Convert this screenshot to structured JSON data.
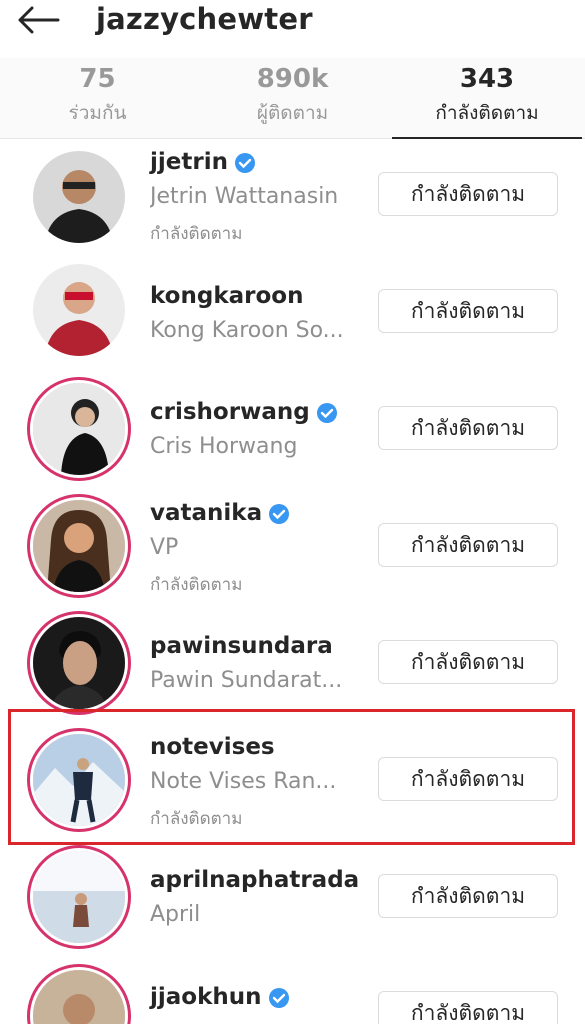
{
  "header": {
    "title": "jazzychewter",
    "back_icon": "arrow-left-icon"
  },
  "stats": [
    {
      "value": "75",
      "label": "ร่วมกัน"
    },
    {
      "value": "890k",
      "label": "ผู้ติดตาม"
    },
    {
      "value": "343",
      "label": "กำลังติดตาม"
    }
  ],
  "users": [
    {
      "username": "jjetrin",
      "verified": true,
      "fullname": "Jetrin Wattanasin",
      "sub": "กำลังติดตาม",
      "button": "กำลังติดตาม"
    },
    {
      "username": "kongkaroon",
      "verified": false,
      "fullname": "Kong Karoon So...",
      "sub": "",
      "button": "กำลังติดตาม"
    },
    {
      "username": "crishorwang",
      "verified": true,
      "fullname": "Cris Horwang",
      "sub": "",
      "button": "กำลังติดตาม"
    },
    {
      "username": "vatanika",
      "verified": true,
      "fullname": "VP",
      "sub": "กำลังติดตาม",
      "button": "กำลังติดตาม"
    },
    {
      "username": "pawinsundara",
      "verified": false,
      "fullname": "Pawin Sundarat...",
      "sub": "",
      "button": "กำลังติดตาม"
    },
    {
      "username": "notevises",
      "verified": false,
      "fullname": "Note Vises Ran...",
      "sub": "กำลังติดตาม",
      "button": "กำลังติดตาม"
    },
    {
      "username": "aprilnaphatrada",
      "verified": false,
      "fullname": "April",
      "sub": "",
      "button": "กำลังติดตาม"
    },
    {
      "username": "jjaokhun",
      "verified": true,
      "fullname": "",
      "sub": "",
      "button": "กำลังติดตาม"
    }
  ],
  "colors": {
    "story_ring": "#d6336c",
    "verified_blue": "#3897f0",
    "highlight": "#d9262b"
  }
}
